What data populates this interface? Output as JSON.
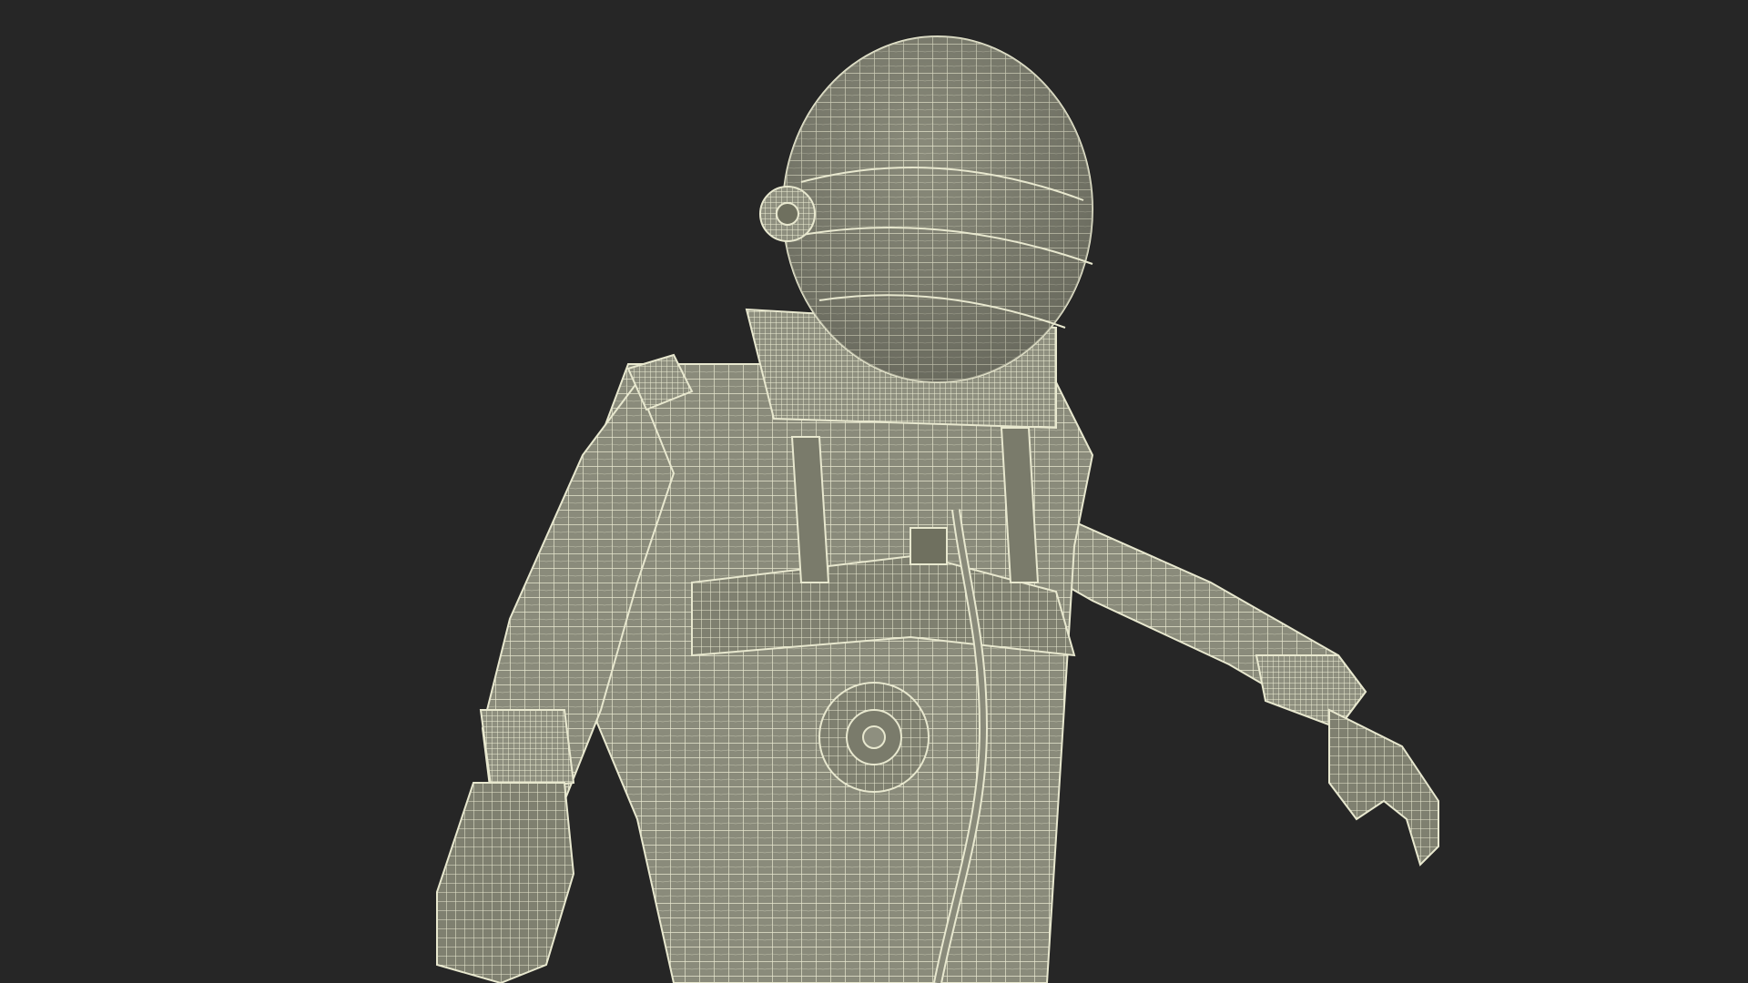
{
  "scene": {
    "subject": "astronaut-wireframe-render",
    "colors": {
      "background": "#262626",
      "suit_fill": "#8a8b7b",
      "suit_shade": "#6f705f",
      "wire": "#e8e8cf"
    }
  }
}
